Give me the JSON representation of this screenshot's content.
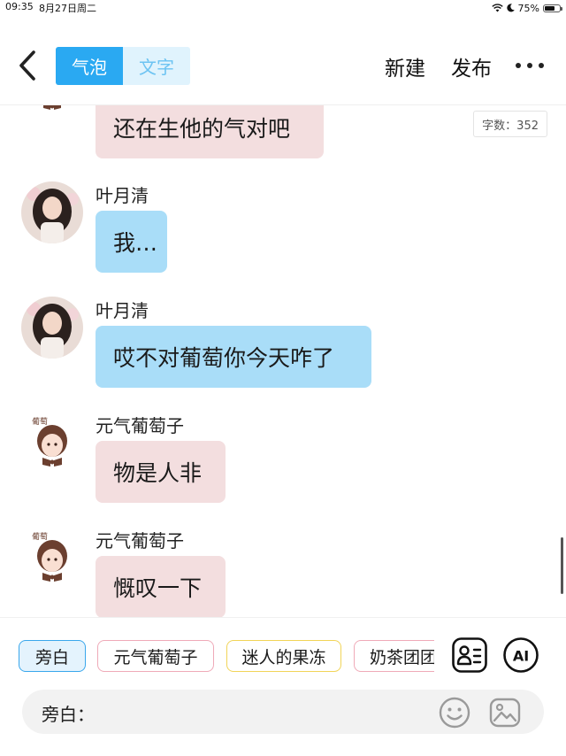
{
  "status": {
    "time": "09:35",
    "date": "8月27日周二",
    "battery": "75%",
    "battery_level": 0.75
  },
  "header": {
    "tabs": [
      {
        "label": "气泡",
        "active": true
      },
      {
        "label": "文字",
        "active": false
      }
    ],
    "new_label": "新建",
    "publish_label": "发布",
    "icons": {
      "back": "chevron-left-icon",
      "more": "more-dots-icon"
    }
  },
  "word_count": "字数：352",
  "messages": [
    {
      "sender": "",
      "text": "还在生他的气对吧",
      "bubble_color": "#f3dedf",
      "avatar": "chibi-girl-avatar"
    },
    {
      "sender": "叶月清",
      "text": "我…",
      "bubble_color": "#a9ddf8",
      "avatar": "photo-girl-avatar"
    },
    {
      "sender": "叶月清",
      "text": "哎不对葡萄你今天咋了",
      "bubble_color": "#a9ddf8",
      "avatar": "photo-girl-avatar"
    },
    {
      "sender": "元气葡萄子",
      "text": "物是人非",
      "bubble_color": "#f3dedf",
      "avatar": "chibi-girl-avatar"
    },
    {
      "sender": "元气葡萄子",
      "text": "慨叹一下",
      "bubble_color": "#f3dedf",
      "avatar": "chibi-girl-avatar"
    }
  ],
  "characters": [
    {
      "label": "旁白",
      "border": "#3aa7ec",
      "selected": true
    },
    {
      "label": "元气葡萄子",
      "border": "#efaab8",
      "selected": false
    },
    {
      "label": "迷人的果冻",
      "border": "#f1d458",
      "selected": false
    },
    {
      "label": "奶茶团团",
      "border": "#efaab8",
      "selected": false
    }
  ],
  "input": {
    "label": "旁白：",
    "value": "",
    "placeholder": ""
  },
  "icons": {
    "character_card": "character-card-icon",
    "ai": "ai-icon",
    "emoji": "emoji-icon",
    "image": "image-icon"
  },
  "ai_icon_text": "AI",
  "colors": {
    "accent": "#2aa9f2",
    "bubble_pink": "#f3dedf",
    "bubble_blue": "#a9ddf8"
  }
}
